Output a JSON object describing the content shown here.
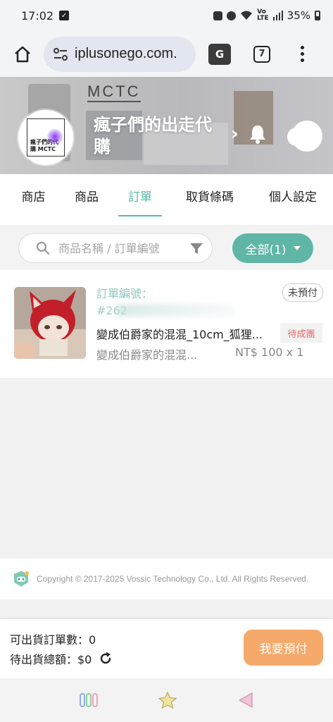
{
  "status_bar": {
    "time": "17:02",
    "battery": "35%"
  },
  "browser": {
    "url": "iplusonego.com.",
    "tab_count": "7"
  },
  "banner": {
    "brand": "MCTC",
    "logo_text": "瘋子們的代購 MCTC",
    "shop_name": "瘋子們的出走代購"
  },
  "nav": {
    "tabs": [
      "商店",
      "商品",
      "訂單",
      "取貨條碼",
      "個人設定"
    ],
    "active": "訂單"
  },
  "search": {
    "placeholder": "商品名稱 / 訂單編號",
    "filter_label": "全部(1)"
  },
  "order": {
    "number_label": "訂單編號：",
    "number_value": "#262",
    "status": "未預付",
    "item_title": "變成伯爵家的混混_10cm_狐狸...",
    "group_status": "待成團",
    "item_subtitle": "變成伯爵家的混混...",
    "price": "NT$ 100 x 1"
  },
  "footer": {
    "copyright": "Copyright © 2017-2025 Vossic Technology Co., Ltd. All Rights Reserved."
  },
  "summary": {
    "shippable_orders": "可出貨訂單數：0",
    "pending_total": "待出貨總額：$0",
    "pay_button": "我要預付"
  },
  "colors": {
    "accent": "#5fb6a6",
    "pay": "#f5a96a",
    "group_badge_text": "#e06a6a"
  }
}
